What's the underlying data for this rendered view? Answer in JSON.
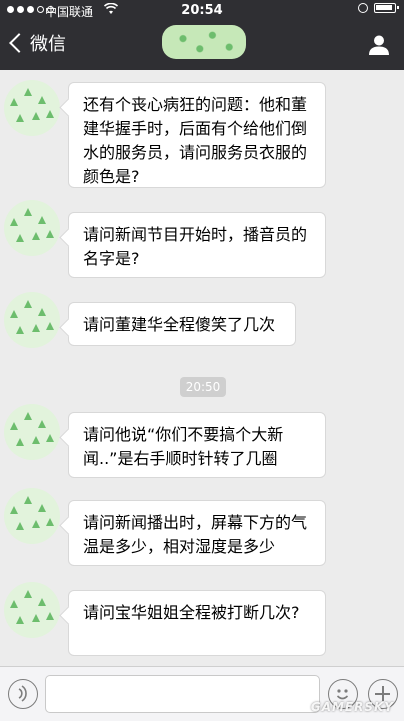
{
  "status_bar": {
    "carrier": "中国联通",
    "time": "20:54"
  },
  "nav": {
    "back_label": "微信"
  },
  "messages": [
    {
      "text": "还有个丧心病狂的问题：他和董建华握手时，后面有个给他们倒水的服务员，请问服务员衣服的颜色是?"
    },
    {
      "text": "请问新闻节目开始时，播音员的名字是?"
    },
    {
      "text": "请问董建华全程傻笑了几次"
    },
    {
      "text": "请问他说“你们不要搞个大新闻..”是右手顺时针转了几圈"
    },
    {
      "text": "请问新闻播出时，屏幕下方的气温是多少，相对湿度是多少"
    },
    {
      "text": "请问宝华姐姐全程被打断几次?"
    }
  ],
  "timestamp": "20:50",
  "watermark": "GAMERSKY",
  "icons": {
    "wifi": "wifi-icon",
    "lock": "rotation-lock-icon",
    "battery": "battery-icon",
    "back": "chevron-left-icon",
    "profile": "person-icon",
    "voice": "voice-icon",
    "emoji": "emoji-icon",
    "plus": "plus-icon"
  },
  "colors": {
    "header_bg": "#2f2f33",
    "chat_bg": "#ececec",
    "avatar_green": "#6dbd6d"
  }
}
